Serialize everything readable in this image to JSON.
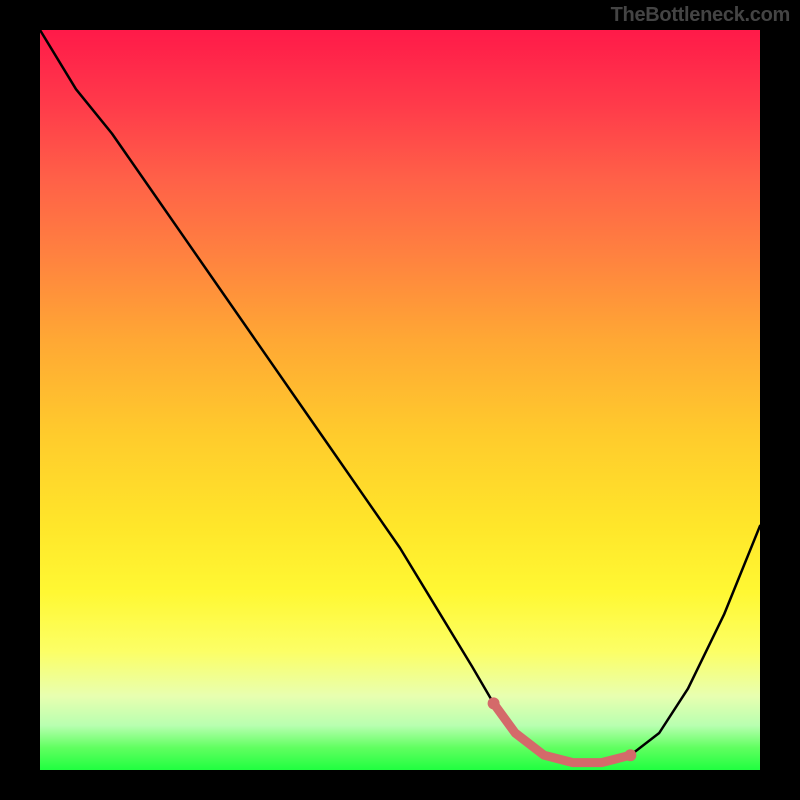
{
  "watermark": "TheBottleneck.com",
  "chart_data": {
    "type": "line",
    "title": "",
    "xlabel": "",
    "ylabel": "",
    "xlim": [
      0,
      100
    ],
    "ylim": [
      0,
      100
    ],
    "grid": false,
    "gradient": {
      "direction": "vertical",
      "stops": [
        {
          "pos": 0,
          "color": "#ff1a49"
        },
        {
          "pos": 0.1,
          "color": "#ff3a4a"
        },
        {
          "pos": 0.2,
          "color": "#ff6048"
        },
        {
          "pos": 0.3,
          "color": "#ff8040"
        },
        {
          "pos": 0.42,
          "color": "#ffa834"
        },
        {
          "pos": 0.55,
          "color": "#ffcc2c"
        },
        {
          "pos": 0.67,
          "color": "#ffe62a"
        },
        {
          "pos": 0.76,
          "color": "#fff833"
        },
        {
          "pos": 0.84,
          "color": "#fcff66"
        },
        {
          "pos": 0.9,
          "color": "#e8ffb0"
        },
        {
          "pos": 0.94,
          "color": "#b8ffb0"
        },
        {
          "pos": 0.97,
          "color": "#60ff60"
        },
        {
          "pos": 1.0,
          "color": "#20ff40"
        }
      ]
    },
    "series": [
      {
        "name": "bottleneck-curve",
        "color": "#000000",
        "x": [
          0,
          5,
          10,
          15,
          20,
          25,
          30,
          35,
          40,
          45,
          50,
          55,
          60,
          63,
          66,
          70,
          74,
          78,
          82,
          86,
          90,
          95,
          100
        ],
        "y": [
          100,
          92,
          86,
          79,
          72,
          65,
          58,
          51,
          44,
          37,
          30,
          22,
          14,
          9,
          5,
          2,
          1,
          1,
          2,
          5,
          11,
          21,
          33
        ]
      }
    ],
    "highlight": {
      "name": "optimal-range",
      "color": "#d46a6a",
      "x": [
        63,
        66,
        70,
        74,
        78,
        82
      ],
      "y": [
        9,
        5,
        2,
        1,
        1,
        2
      ]
    },
    "annotations": []
  }
}
